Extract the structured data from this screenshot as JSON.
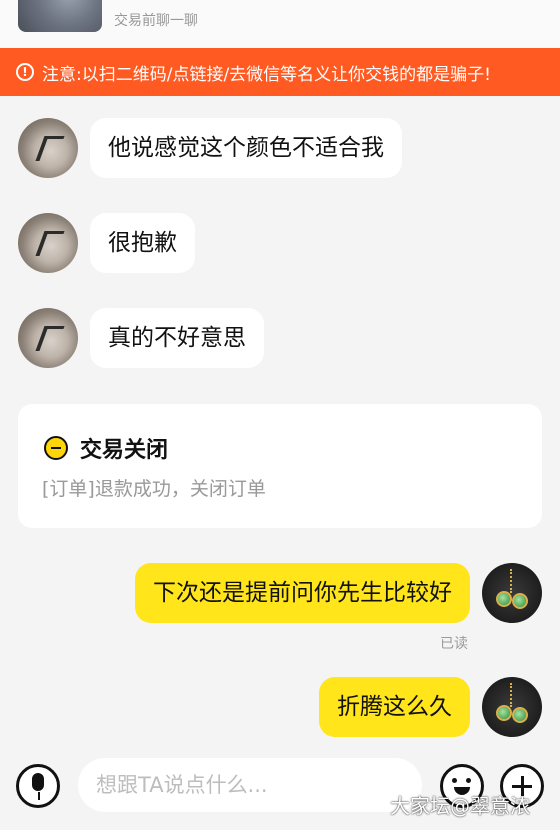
{
  "header": {
    "product_title": "",
    "product_subtitle": "交易前聊一聊"
  },
  "warning": {
    "text": "注意:以扫二维码/点链接/去微信等名义让你交钱的都是骗子!",
    "color": "#ff5a22"
  },
  "messages": [
    {
      "side": "other",
      "text": "他说感觉这个颜色不适合我"
    },
    {
      "side": "other",
      "text": "很抱歉"
    },
    {
      "side": "other",
      "text": "真的不好意思"
    },
    {
      "side": "self",
      "text": "下次还是提前问你先生比较好",
      "status": "已读"
    },
    {
      "side": "self",
      "text": "折腾这么久"
    }
  ],
  "order_card": {
    "title": "交易关闭",
    "subtitle": "[订单]退款成功，关闭订单"
  },
  "input_bar": {
    "placeholder": "想跟TA说点什么...",
    "value": ""
  },
  "icons": {
    "voice": "microphone-icon",
    "emoji": "smiley-icon",
    "more": "plus-icon"
  },
  "watermark": "大家坛@翠意浓",
  "colors": {
    "self_bubble": "#ffe51a",
    "other_bubble": "#ffffff",
    "background": "#f4f4f4"
  }
}
